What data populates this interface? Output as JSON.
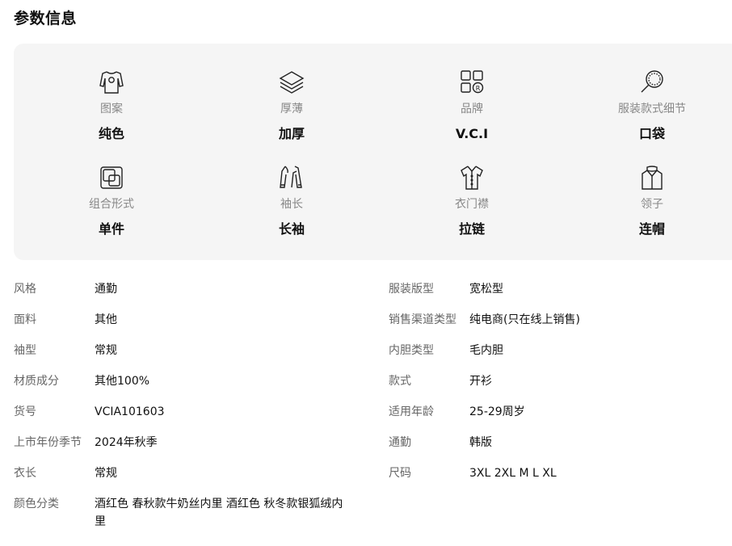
{
  "section_title": "参数信息",
  "features": [
    {
      "icon": "shirt-pattern-icon",
      "label": "图案",
      "value": "纯色"
    },
    {
      "icon": "layers-icon",
      "label": "厚薄",
      "value": "加厚"
    },
    {
      "icon": "brand-icon",
      "label": "品牌",
      "value": "V.C.I"
    },
    {
      "icon": "magnifier-icon",
      "label": "服装款式细节",
      "value": "口袋"
    },
    {
      "icon": "combination-icon",
      "label": "组合形式",
      "value": "单件"
    },
    {
      "icon": "sleeve-icon",
      "label": "袖长",
      "value": "长袖"
    },
    {
      "icon": "placket-shirt-icon",
      "label": "衣门襟",
      "value": "拉链"
    },
    {
      "icon": "collar-icon",
      "label": "领子",
      "value": "连帽"
    }
  ],
  "specs_left": [
    {
      "key": "风格",
      "value": "通勤"
    },
    {
      "key": "面料",
      "value": "其他"
    },
    {
      "key": "袖型",
      "value": "常规"
    },
    {
      "key": "材质成分",
      "value": "其他100%"
    },
    {
      "key": "货号",
      "value": "VCIA101603"
    },
    {
      "key": "上市年份季节",
      "value": "2024年秋季"
    },
    {
      "key": "衣长",
      "value": "常规"
    },
    {
      "key": "颜色分类",
      "value": "酒红色 春秋款牛奶丝内里 酒红色 秋冬款银狐绒内里"
    }
  ],
  "specs_right": [
    {
      "key": "服装版型",
      "value": "宽松型"
    },
    {
      "key": "销售渠道类型",
      "value": "纯电商(只在线上销售)"
    },
    {
      "key": "内胆类型",
      "value": "毛内胆"
    },
    {
      "key": "款式",
      "value": "开衫"
    },
    {
      "key": "适用年龄",
      "value": "25-29周岁"
    },
    {
      "key": "通勤",
      "value": "韩版"
    },
    {
      "key": "尺码",
      "value": "3XL 2XL M L XL"
    }
  ]
}
